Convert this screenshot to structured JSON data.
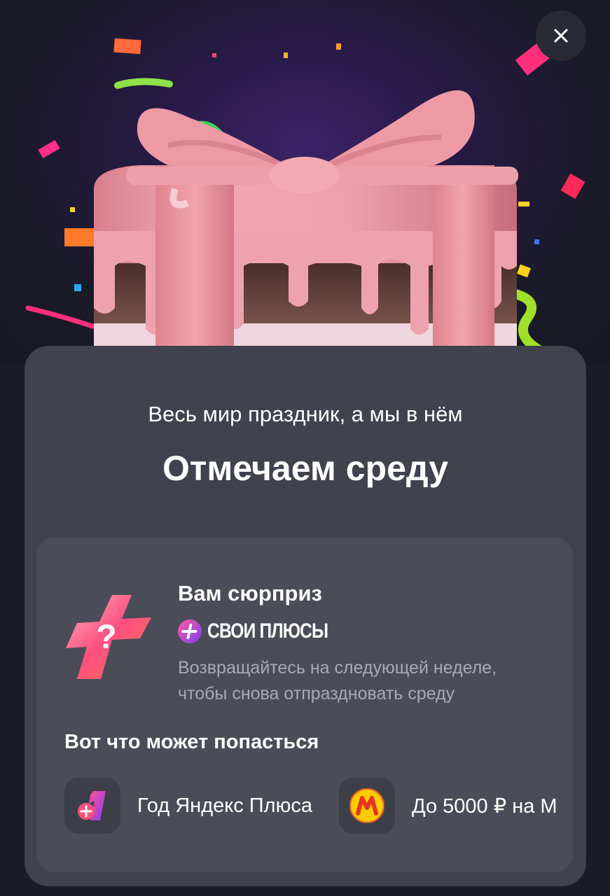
{
  "header": {
    "close_label": "×"
  },
  "promo": {
    "subtitle": "Весь мир праздник, а мы в нём",
    "title": "Отмечаем среду"
  },
  "surprise": {
    "title": "Вам сюрприз",
    "brand_name": "СВОИ ПЛЮСЫ",
    "description": "Возвращайтесь на следующей неделе, чтобы снова отпраздновать среду"
  },
  "prizes": {
    "title": "Вот что может попасться",
    "items": [
      {
        "label": "Год Яндекс Плюса",
        "icon": "yandex-plus-one-icon"
      },
      {
        "label": "До 5000 ₽ на М",
        "icon": "yandex-market-icon"
      }
    ]
  },
  "colors": {
    "background": "#1c1b28",
    "sheet": "#40424d",
    "card": "#4a4c57",
    "accent_pink": "#f0487a",
    "accent_purple": "#7b3ff2",
    "market_yellow": "#ffcc00"
  }
}
